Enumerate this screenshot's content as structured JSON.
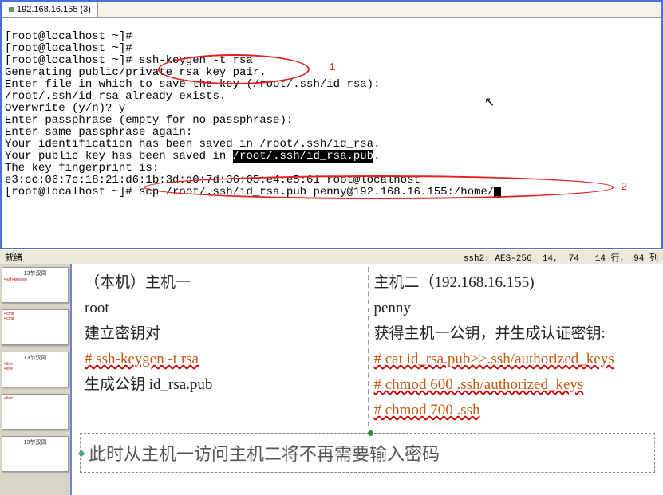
{
  "tab": {
    "title": "192.168.16.155 (3)"
  },
  "terminal": {
    "l01": "[root@localhost ~]#",
    "l02": "[root@localhost ~]#",
    "l03a": "[root@localhost ~]# ",
    "l03b": "ssh-keygen -t rsa",
    "l04": "Generating public/private rsa key pair.",
    "l05": "Enter file in which to save the key (/root/.ssh/id_rsa):",
    "l06": "/root/.ssh/id_rsa already exists.",
    "l07": "Overwrite (y/n)? y",
    "l08": "Enter passphrase (empty for no passphrase):",
    "l09": "Enter same passphrase again:",
    "l10": "Your identification has been saved in /root/.ssh/id_rsa.",
    "l11a": "Your public key has been saved in ",
    "l11b": "/root/.ssh/id_rsa.pub",
    "l11c": ".",
    "l12": "The key fingerprint is:",
    "l13": "e3:cc:06:7c:18:21:d6:1b:3d:d0:7d:36:05:e4:e5:61 root@localhost",
    "l14": "[root@localhost ~]# scp /root/.ssh/id_rsa.pub penny@192.168.16.155:/home/"
  },
  "annot": {
    "one": "1",
    "two": "2"
  },
  "status": {
    "left": "就绪",
    "right": "ssh2: AES-256  14,  74   14 行， 94 列"
  },
  "slide": {
    "left": {
      "h1": "（本机）主机一",
      "h2": "root",
      "h3": "建立密钥对",
      "c1": "# ssh-keygen -t rsa",
      "h4": "生成公钥 id_rsa.pub"
    },
    "right": {
      "h1": "主机二（192.168.16.155)",
      "h2": "penny",
      "h3": "获得主机一公钥，并生成认证密钥:",
      "c1": "# cat id_rsa.pub>>.ssh/authorized_keys",
      "c2": "# chmod 600 .ssh/authorized_keys",
      "c3": "# chmod 700 .ssh"
    },
    "caption": "此时从主机一访问主机二将不再需要输入密码"
  },
  "thumb_title": "13节双周"
}
